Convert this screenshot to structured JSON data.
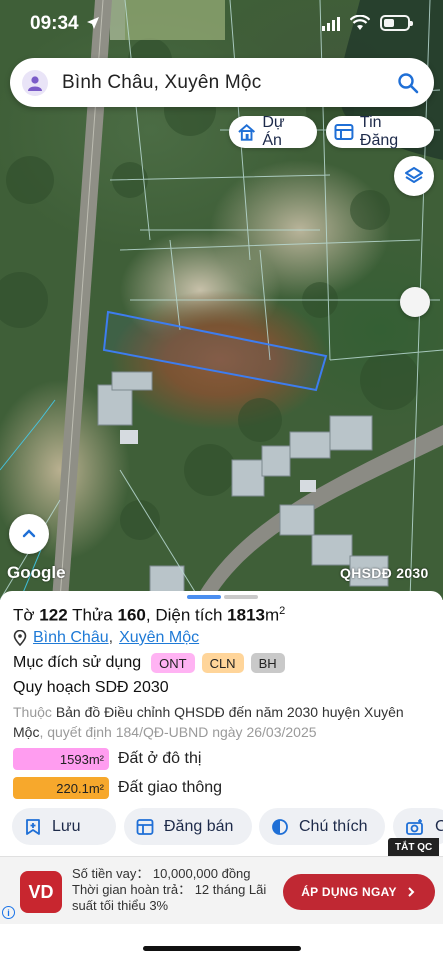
{
  "status_bar": {
    "time": "09:34"
  },
  "search": {
    "query": "Bình Châu, Xuyên Mộc"
  },
  "chips": {
    "project": "Dự Án",
    "listing": "Tin Đăng"
  },
  "map": {
    "attribution": "Google",
    "layer_label": "QHSDĐ 2030"
  },
  "parcel": {
    "sheet_label": "Tờ",
    "sheet_no": "122",
    "plot_label": "Thửa",
    "plot_no": "160",
    "area_label": ", Diện tích",
    "area_value": "1813",
    "area_unit": "m",
    "ward": "Bình Châu",
    "district": "Xuyên Mộc"
  },
  "land_use": {
    "label": "Mục đích sử dụng",
    "badges": [
      "ONT",
      "CLN",
      "BH"
    ]
  },
  "plan": {
    "title": "Quy hoạch SDĐ 2030",
    "prefix": "Thuộc",
    "map_name": "Bản đồ Điều chỉnh QHSDĐ đến năm 2030 huyện Xuyên Mộc",
    "decision": ", quyết định 184/QĐ-UBND ngày 26/03/2025"
  },
  "areas": [
    {
      "value": "1593m²",
      "label": "Đất ở đô thị",
      "color": "#ff9df0"
    },
    {
      "value": "220.1m²",
      "label": "Đất giao thông",
      "color": "#f7a82c"
    }
  ],
  "actions": {
    "save": "Lưu",
    "post": "Đăng bán",
    "legend": "Chú thích",
    "more": "C"
  },
  "ad": {
    "close": "TẮT QC",
    "logo_text": "VD",
    "copy": "Số tiền vay： 10,000,000 đồng Thời gian hoàn trả： 12 tháng Lãi suất tối thiểu 3%",
    "cta": "ÁP DỤNG NGAY",
    "info": "i"
  },
  "colors": {
    "accent": "#1f7ad6",
    "parcel_outline": "#3d7df0",
    "cta": "#c02833"
  }
}
